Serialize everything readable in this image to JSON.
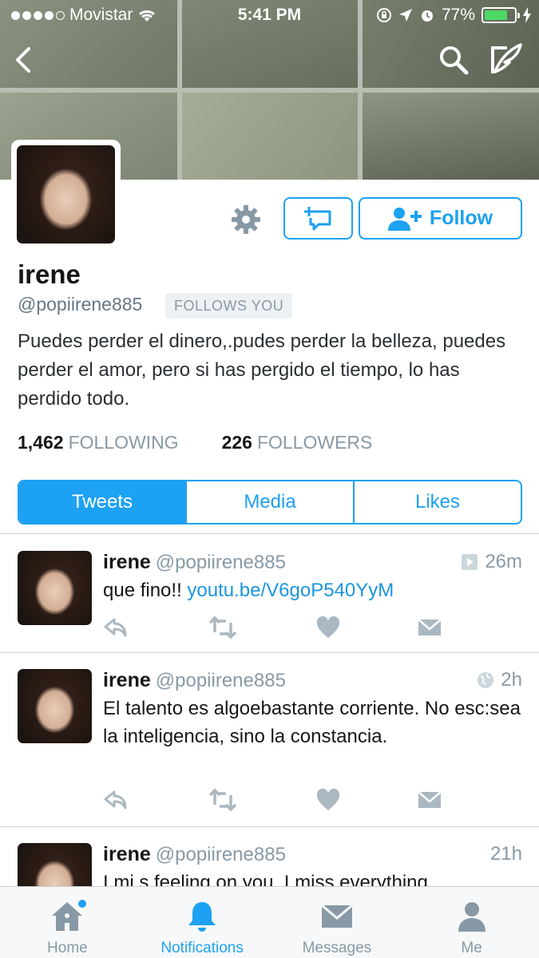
{
  "status_bar": {
    "carrier": "Movistar",
    "time": "5:41 PM",
    "battery": "77%",
    "battery_level": 0.77
  },
  "profile": {
    "name": "irene",
    "handle": "@popiirene885",
    "follows_you": "FOLLOWS YOU",
    "bio": "Puedes perder el dinero,.pudes perder la belleza, puedes perder el amor, pero si has pergido el tiempo, lo has perdido todo.",
    "following_count": "1,462",
    "following_label": "FOLLOWING",
    "followers_count": "226",
    "followers_label": "FOLLOWERS",
    "follow_label": "Follow"
  },
  "tabs": [
    {
      "label": "Tweets",
      "active": true
    },
    {
      "label": "Media",
      "active": false
    },
    {
      "label": "Likes",
      "active": false
    }
  ],
  "tweets": [
    {
      "name": "irene",
      "handle": "@popiirene885",
      "time": "26m",
      "source_icon": "play-icon",
      "text": "que fino!!",
      "link": "youtu.be/V6goP540YyM"
    },
    {
      "name": "irene",
      "handle": "@popiirene885",
      "time": "2h",
      "source_icon": "globe-icon",
      "text": "El talento es algoebastante corriente. No esc:sea la inteligencia, sino la constancia."
    },
    {
      "name": "irene",
      "handle": "@popiirene885",
      "time": "21h",
      "text": "I mi s feeling on you. I miss everything"
    }
  ],
  "tab_bar": [
    {
      "label": "Home",
      "icon": "home-icon",
      "active": false,
      "badge": true
    },
    {
      "label": "Notifications",
      "icon": "bell-icon",
      "active": true,
      "badge": false
    },
    {
      "label": "Messages",
      "icon": "envelope-icon",
      "active": false,
      "badge": false
    },
    {
      "label": "Me",
      "icon": "person-icon",
      "active": false,
      "badge": false
    }
  ],
  "colors": {
    "accent": "#1da1f2",
    "link": "#1b95e0",
    "muted": "#8899a6",
    "battery": "#4cd964"
  }
}
